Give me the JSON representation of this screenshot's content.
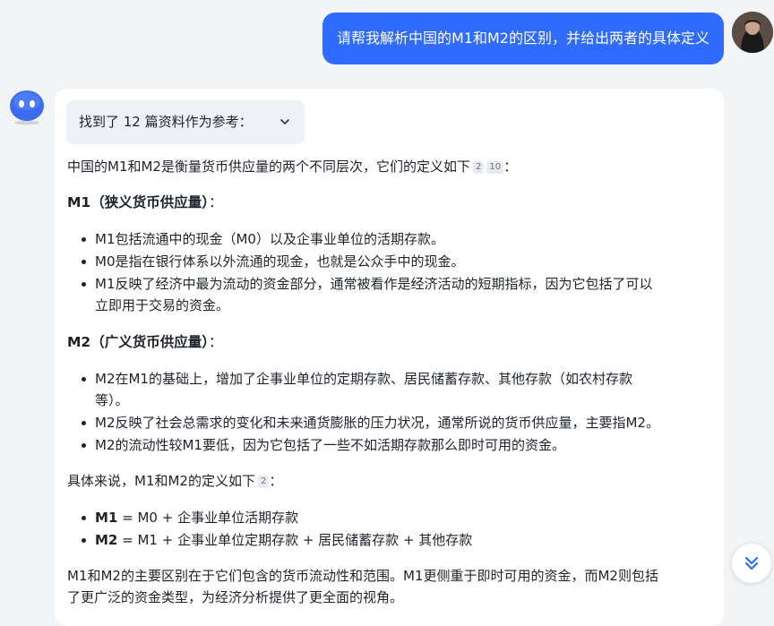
{
  "user": {
    "question": "请帮我解析中国的M1和M2的区别，并给出两者的具体定义"
  },
  "references": {
    "label": "找到了 12 篇资料作为参考："
  },
  "answer": {
    "intro": "中国的M1和M2是衡量货币供应量的两个不同层次，它们的定义如下",
    "intro_cites": [
      "2",
      "10"
    ],
    "intro_end": "：",
    "m1": {
      "heading": "M1（狭义货币供应量）",
      "heading_suffix": "：",
      "items": [
        "M1包括流通中的现金（M0）以及企事业单位的活期存款。",
        "M0是指在银行体系以外流通的现金，也就是公众手中的现金。",
        "M1反映了经济中最为流动的资金部分，通常被看作是经济活动的短期指标，因为它包括了可以",
        "立即用于交易的资金。"
      ]
    },
    "m2": {
      "heading": "M2（广义货币供应量）",
      "heading_suffix": "：",
      "items": [
        "M2在M1的基础上，增加了企事业单位的定期存款、居民储蓄存款、其他存款（如农村存款",
        "等）。",
        "M2反映了社会总需求的变化和未来通货膨胀的压力状况，通常所说的货币供应量，主要指M2。",
        "M2的流动性较M1要低，因为它包括了一些不如活期存款那么即时可用的资金。"
      ]
    },
    "specific": {
      "intro": "具体来说，M1和M2的定义如下",
      "cite": "2",
      "intro_end": "：",
      "m1_label": "M1",
      "m1_formula": " = M0 + 企事业单位活期存款",
      "m2_label": "M2",
      "m2_formula": " = M1 + 企事业单位定期存款 + 居民储蓄存款 + 其他存款"
    },
    "conclusion": [
      "M1和M2的主要区别在于它们包含的货币流动性和范围。M1更侧重于即时可用的资金，而M2则包括",
      "了更广泛的资金类型，为经济分析提供了更全面的视角。"
    ]
  },
  "icons": {
    "scroll": "double-chevron-down-icon",
    "expand": "chevron-down-icon"
  },
  "colors": {
    "accent": "#2f6bff",
    "card": "#ffffff",
    "background": "#f3f4f6"
  }
}
